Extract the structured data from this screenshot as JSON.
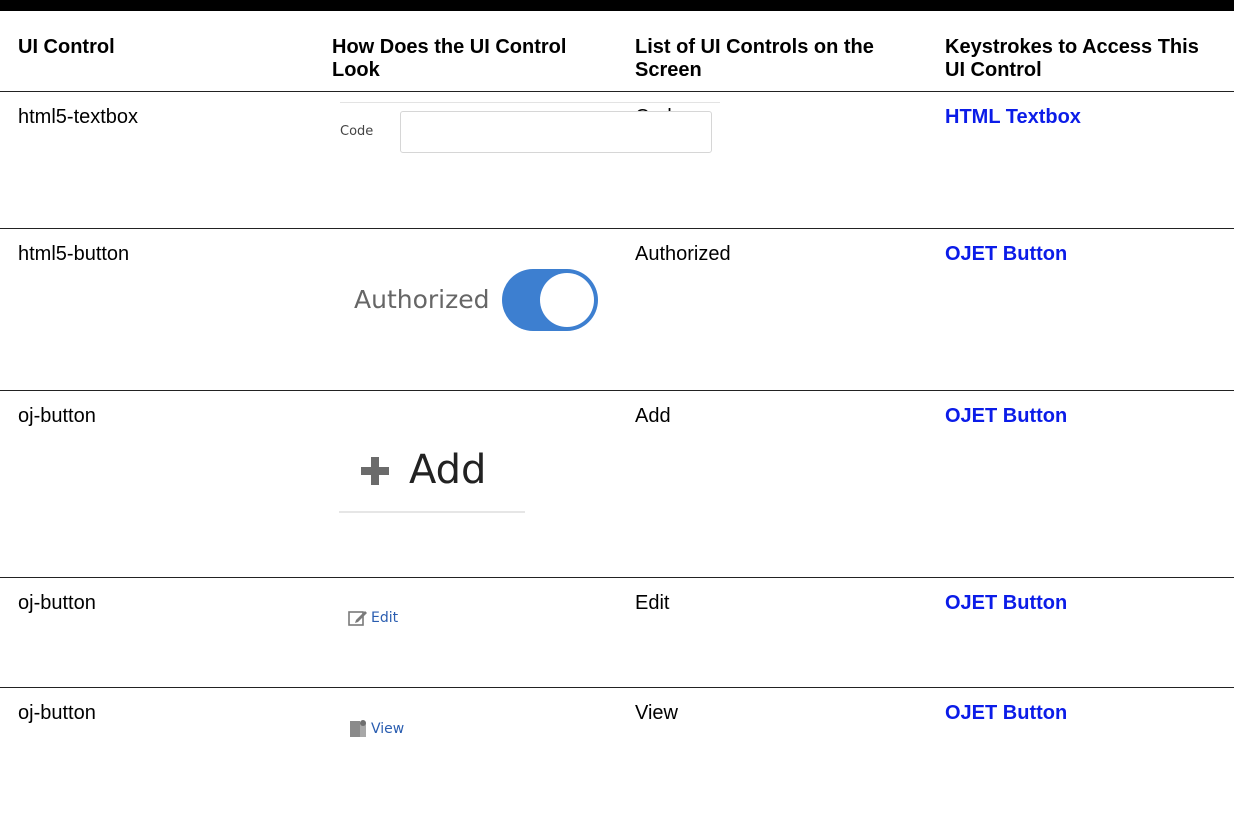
{
  "headers": {
    "col1": "UI Control",
    "col2": "How Does the UI Control Look",
    "col3": "List of UI Controls on the Screen",
    "col4": "Keystrokes to Access This UI Control"
  },
  "rows": [
    {
      "control": "html5-textbox",
      "look_label": "Code",
      "list": "Code",
      "keystrokes": "HTML Textbox"
    },
    {
      "control": "html5-button",
      "look_label": "Authorized",
      "list": "Authorized",
      "keystrokes": "OJET Button",
      "switch_on": true
    },
    {
      "control": "oj-button",
      "look_label": "Add",
      "list": "Add",
      "keystrokes": "OJET Button"
    },
    {
      "control": "oj-button",
      "look_label": "Edit",
      "list": "Edit",
      "keystrokes": "OJET Button"
    },
    {
      "control": "oj-button",
      "look_label": "View",
      "list": "View",
      "keystrokes": "OJET Button"
    }
  ],
  "colors": {
    "link": "#0b1ce8",
    "switch_track": "#3d7fd0",
    "button_text": "#2a5db0"
  },
  "icons": [
    "plus-icon",
    "edit-icon",
    "view-icon"
  ]
}
